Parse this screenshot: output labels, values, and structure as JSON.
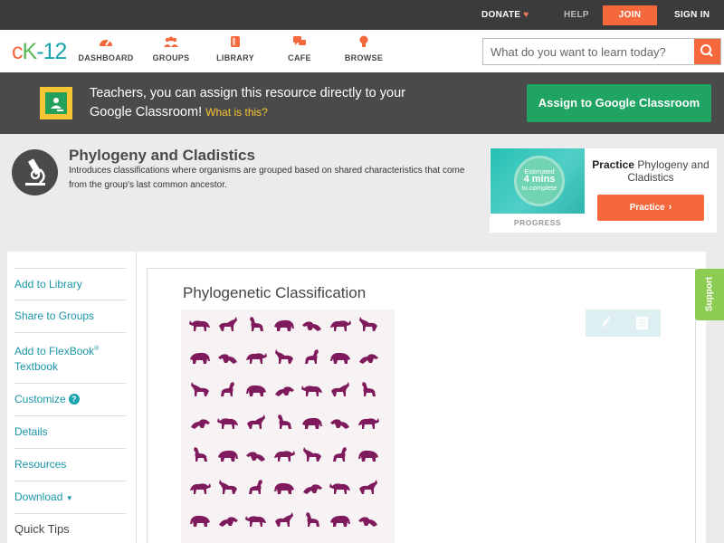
{
  "topbar": {
    "donate": "DONATE",
    "help": "HELP",
    "join": "JOIN",
    "signin": "SIGN IN"
  },
  "logo": {
    "part1": "c",
    "part2": "K",
    "part3": "-12"
  },
  "nav": {
    "items": [
      {
        "label": "DASHBOARD",
        "icon": "dashboard-icon"
      },
      {
        "label": "GROUPS",
        "icon": "groups-icon"
      },
      {
        "label": "LIBRARY",
        "icon": "library-icon"
      },
      {
        "label": "CAFE",
        "icon": "cafe-icon"
      },
      {
        "label": "BROWSE",
        "icon": "browse-icon"
      }
    ]
  },
  "search": {
    "placeholder": "What do you want to learn today?"
  },
  "gc_banner": {
    "text": "Teachers, you can assign this resource directly to your Google Classroom!",
    "link": "What is this?",
    "button": "Assign to Google Classroom"
  },
  "concept": {
    "title": "Phylogeny and Cladistics",
    "description": "Introduces classifications where organisms are grouped based on shared characteristics that come from the group's last common ancestor."
  },
  "practice": {
    "estimated_label": "Estimated",
    "estimated_value": "4 mins",
    "estimated_suffix": "to complete",
    "progress_label": "PROGRESS",
    "title_bold": "Practice",
    "title_rest": "Phylogeny and Cladistics",
    "button": "Practice"
  },
  "sidebar": {
    "items": [
      {
        "label": "Add to Library"
      },
      {
        "label": "Share to Groups"
      },
      {
        "label": "Add to FlexBook",
        "sup": "®",
        "label2": "Textbook"
      },
      {
        "label": "Customize"
      },
      {
        "label": "Details"
      },
      {
        "label": "Resources"
      },
      {
        "label": "Download"
      }
    ],
    "quick_tips": "Quick Tips"
  },
  "content": {
    "section_title": "Phylogenetic Classification"
  },
  "support": "Support",
  "colors": {
    "accent": "#f4683c",
    "brand_green": "#58b957",
    "link_teal": "#1a96a8",
    "classroom_green": "#1fa463",
    "animal_color": "#7f1a5c"
  }
}
